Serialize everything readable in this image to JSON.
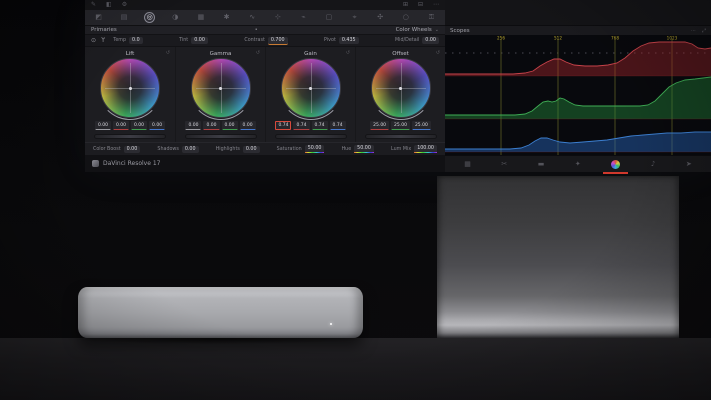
{
  "screen": {
    "viewer_toolbar": {
      "left_icons": [
        {
          "name": "pen-icon",
          "glyph": "✎"
        },
        {
          "name": "wipe-icon",
          "glyph": "◧"
        },
        {
          "name": "settings-icon",
          "glyph": "⚙"
        }
      ],
      "right_icons": [
        {
          "name": "grid-view-icon",
          "glyph": "⊞"
        },
        {
          "name": "single-view-icon",
          "glyph": "⊟"
        },
        {
          "name": "more-icon",
          "glyph": "⋯"
        }
      ]
    },
    "palette_tabs": {
      "items": [
        {
          "name": "camera-raw-icon",
          "glyph": "◩",
          "active": false
        },
        {
          "name": "color-match-icon",
          "glyph": "▤",
          "active": false
        },
        {
          "name": "color-wheels-icon",
          "glyph": "◎",
          "active": true
        },
        {
          "name": "hdr-grade-icon",
          "glyph": "◑",
          "active": false
        },
        {
          "name": "rgb-mixer-icon",
          "glyph": "▦",
          "active": false
        },
        {
          "name": "motion-effects-icon",
          "glyph": "✱",
          "active": false
        },
        {
          "name": "curves-icon",
          "glyph": "∿",
          "active": false
        },
        {
          "name": "color-warper-icon",
          "glyph": "⊹",
          "active": false
        },
        {
          "name": "qualifier-icon",
          "glyph": "⌁",
          "active": false
        },
        {
          "name": "power-window-icon",
          "glyph": "▢",
          "active": false
        },
        {
          "name": "tracker-icon",
          "glyph": "⌖",
          "active": false
        },
        {
          "name": "magic-mask-icon",
          "glyph": "✣",
          "active": false
        },
        {
          "name": "blur-icon",
          "glyph": "○",
          "active": false
        },
        {
          "name": "key-icon",
          "glyph": "⚿",
          "active": false
        }
      ]
    },
    "primaries": {
      "title": "Primaries",
      "center_dot": "•",
      "mode_label": "Color Wheels",
      "mode_chevron": "⌄",
      "left_tools": [
        {
          "name": "auto-balance-icon",
          "glyph": "⊙"
        },
        {
          "name": "white-balance-picker-icon",
          "glyph": "ϒ"
        }
      ],
      "adjustments": [
        {
          "label": "Temp",
          "value": "0.0",
          "underline": "none"
        },
        {
          "label": "Tint",
          "value": "0.00",
          "underline": "none"
        },
        {
          "label": "Contrast",
          "value": "0.700",
          "underline": "accent"
        },
        {
          "label": "Pivot",
          "value": "0.435",
          "underline": "none"
        },
        {
          "label": "Mid/Detail",
          "value": "0.00",
          "underline": "none"
        }
      ],
      "wheels": [
        {
          "name": "Lift",
          "reset_glyph": "↺",
          "channels": [
            {
              "value": "0.00",
              "ch": "m",
              "selected": false
            },
            {
              "value": "0.00",
              "ch": "r",
              "selected": false
            },
            {
              "value": "0.00",
              "ch": "g",
              "selected": false
            },
            {
              "value": "0.00",
              "ch": "b",
              "selected": false
            }
          ]
        },
        {
          "name": "Gamma",
          "reset_glyph": "↺",
          "channels": [
            {
              "value": "0.00",
              "ch": "m",
              "selected": false
            },
            {
              "value": "0.00",
              "ch": "r",
              "selected": false
            },
            {
              "value": "0.00",
              "ch": "g",
              "selected": false
            },
            {
              "value": "0.00",
              "ch": "b",
              "selected": false
            }
          ]
        },
        {
          "name": "Gain",
          "reset_glyph": "↺",
          "channels": [
            {
              "value": "0.74",
              "ch": "m",
              "selected": true
            },
            {
              "value": "0.74",
              "ch": "r",
              "selected": false
            },
            {
              "value": "0.74",
              "ch": "g",
              "selected": false
            },
            {
              "value": "0.74",
              "ch": "b",
              "selected": false
            }
          ]
        },
        {
          "name": "Offset",
          "reset_glyph": "↺",
          "channels": [
            {
              "value": "25.00",
              "ch": "r",
              "selected": false
            },
            {
              "value": "25.00",
              "ch": "g",
              "selected": false
            },
            {
              "value": "25.00",
              "ch": "b",
              "selected": false
            }
          ]
        }
      ],
      "params": [
        {
          "label": "Color Boost",
          "value": "0.00",
          "underline": "none"
        },
        {
          "label": "Shadows",
          "value": "0.00",
          "underline": "none"
        },
        {
          "label": "Highlights",
          "value": "0.00",
          "underline": "none"
        },
        {
          "label": "Saturation",
          "value": "50.00",
          "underline": "rainbow"
        },
        {
          "label": "Hue",
          "value": "50.00",
          "underline": "rainbow"
        },
        {
          "label": "Lum Mix",
          "value": "100.00",
          "underline": "rainbow"
        }
      ]
    },
    "footer": {
      "brand": "DaVinci Resolve 17"
    },
    "scopes": {
      "title": "Scopes",
      "header_icons": [
        {
          "name": "scope-options-icon",
          "glyph": "⋯"
        },
        {
          "name": "scope-expand-icon",
          "glyph": "⤢"
        }
      ],
      "grid": {
        "x": [
          56,
          113,
          170,
          227
        ],
        "labels": [
          "256",
          "512",
          "768",
          "1023"
        ],
        "line_color": "#5c5c24",
        "label_color": "#b8a62c"
      },
      "chart_data": {
        "type": "area",
        "title": "RGB waveform parade",
        "series": [
          {
            "name": "red",
            "stroke": "#c8434a",
            "fill": "rgba(190,42,48,0.38)",
            "base": 41,
            "points": [
              [
                0,
                39
              ],
              [
                50,
                39
              ],
              [
                68,
                39
              ],
              [
                80,
                38
              ],
              [
                88,
                36
              ],
              [
                95,
                31
              ],
              [
                102,
                27
              ],
              [
                109,
                24
              ],
              [
                115,
                24
              ],
              [
                121,
                27
              ],
              [
                129,
                30
              ],
              [
                140,
                31
              ],
              [
                152,
                31
              ],
              [
                163,
                30
              ],
              [
                172,
                28
              ],
              [
                180,
                23
              ],
              [
                188,
                16
              ],
              [
                196,
                11
              ],
              [
                204,
                8
              ],
              [
                214,
                7
              ],
              [
                228,
                7
              ],
              [
                240,
                7
              ],
              [
                247,
                9
              ],
              [
                253,
                13
              ],
              [
                260,
                14
              ],
              [
                266,
                13
              ]
            ]
          },
          {
            "name": "green",
            "stroke": "#3fae55",
            "fill": "rgba(40,150,66,0.40)",
            "base": 84,
            "points": [
              [
                0,
                80
              ],
              [
                55,
                80
              ],
              [
                70,
                80
              ],
              [
                80,
                79
              ],
              [
                87,
                76
              ],
              [
                93,
                71
              ],
              [
                98,
                67
              ],
              [
                103,
                66
              ],
              [
                107,
                67
              ],
              [
                111,
                66
              ],
              [
                115,
                63
              ],
              [
                119,
                64
              ],
              [
                124,
                67
              ],
              [
                130,
                70
              ],
              [
                138,
                71
              ],
              [
                150,
                71
              ],
              [
                165,
                71
              ],
              [
                180,
                71
              ],
              [
                195,
                71
              ],
              [
                203,
                70
              ],
              [
                210,
                66
              ],
              [
                217,
                59
              ],
              [
                224,
                52
              ],
              [
                231,
                48
              ],
              [
                240,
                45
              ],
              [
                250,
                44
              ],
              [
                258,
                43
              ],
              [
                266,
                42
              ]
            ]
          },
          {
            "name": "blue",
            "stroke": "#3c7fd0",
            "fill": "rgba(40,105,190,0.45)",
            "base": 117,
            "points": [
              [
                0,
                114
              ],
              [
                50,
                114
              ],
              [
                65,
                114
              ],
              [
                76,
                113
              ],
              [
                84,
                110
              ],
              [
                90,
                106
              ],
              [
                96,
                103
              ],
              [
                102,
                103
              ],
              [
                108,
                105
              ],
              [
                115,
                107
              ],
              [
                125,
                108
              ],
              [
                138,
                107
              ],
              [
                150,
                106
              ],
              [
                162,
                105
              ],
              [
                174,
                103
              ],
              [
                186,
                101
              ],
              [
                198,
                100
              ],
              [
                210,
                99
              ],
              [
                222,
                98
              ],
              [
                236,
                98
              ],
              [
                250,
                97
              ],
              [
                266,
                97
              ]
            ]
          }
        ]
      }
    },
    "page_bar": {
      "pages": [
        {
          "name": "media",
          "glyph": "▦",
          "active": false
        },
        {
          "name": "cut",
          "glyph": "✂",
          "active": false
        },
        {
          "name": "edit",
          "glyph": "▬",
          "active": false
        },
        {
          "name": "fusion",
          "glyph": "✦",
          "active": false
        },
        {
          "name": "color",
          "glyph": "",
          "active": true
        },
        {
          "name": "fairlight",
          "glyph": "♪",
          "active": false
        },
        {
          "name": "deliver",
          "glyph": "➤",
          "active": false
        }
      ]
    }
  },
  "colors": {
    "accent_red": "#d0382c",
    "panel": "#1d1d21",
    "chip_bg": "#2b2b31"
  }
}
